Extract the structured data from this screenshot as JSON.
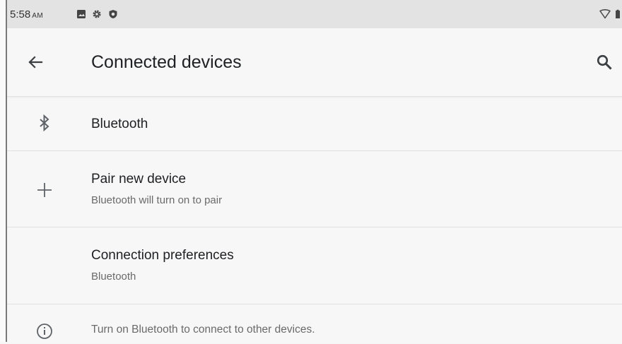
{
  "status_bar": {
    "time": "5:58",
    "ampm": "AM",
    "icons": [
      "image-icon",
      "gear-icon",
      "shield-icon",
      "wifi-icon",
      "battery-icon"
    ]
  },
  "app_bar": {
    "title": "Connected devices",
    "back_icon": "arrow-left-icon",
    "search_icon": "search-icon"
  },
  "list": [
    {
      "icon": "bluetooth-icon",
      "title": "Bluetooth",
      "subtitle": ""
    },
    {
      "icon": "plus-icon",
      "title": "Pair new device",
      "subtitle": "Bluetooth will turn on to pair"
    },
    {
      "icon": "",
      "title": "Connection preferences",
      "subtitle": "Bluetooth"
    }
  ],
  "footer": {
    "icon": "info-icon",
    "text": "Turn on Bluetooth to connect to other devices."
  },
  "colors": {
    "background": "#f7f7f7",
    "status_bar": "#e3e3e3",
    "primary_text": "#202124",
    "secondary_text": "#6a6a6a",
    "icon": "#5f6368"
  }
}
